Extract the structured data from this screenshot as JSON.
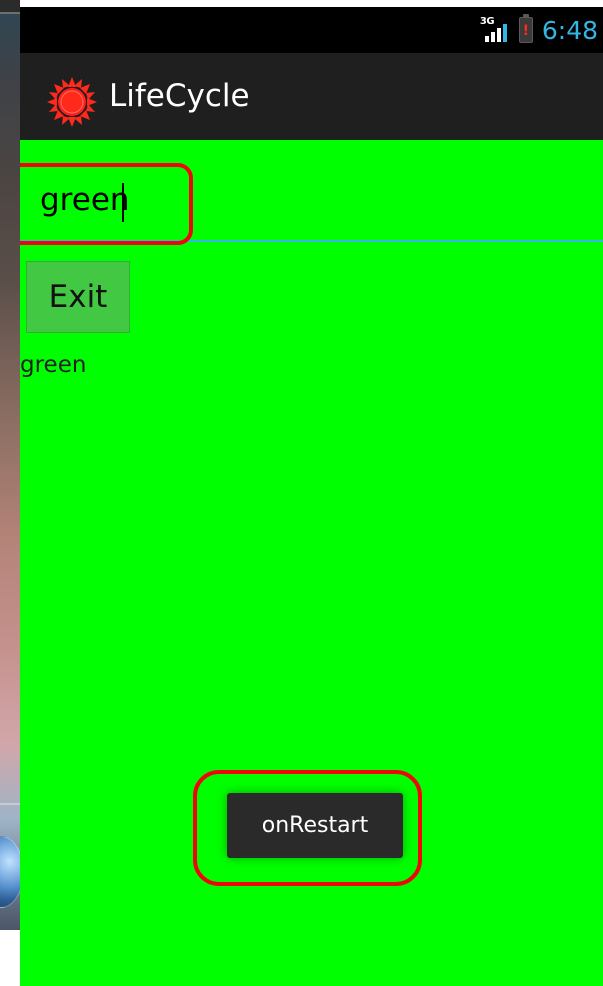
{
  "status_bar": {
    "network": "3G",
    "battery_alert": "!",
    "time": "6:48",
    "accent_color": "#33b5e5"
  },
  "action_bar": {
    "title": "LifeCycle",
    "icon": "sun-icon",
    "background_color": "#1f1f1f"
  },
  "main": {
    "background_color": "#00ff00",
    "input": {
      "value": "green",
      "placeholder": ""
    },
    "exit_button_label": "Exit",
    "status_text": "green"
  },
  "toast": {
    "text": "onRestart"
  },
  "highlights": {
    "color": "#ef0707"
  }
}
